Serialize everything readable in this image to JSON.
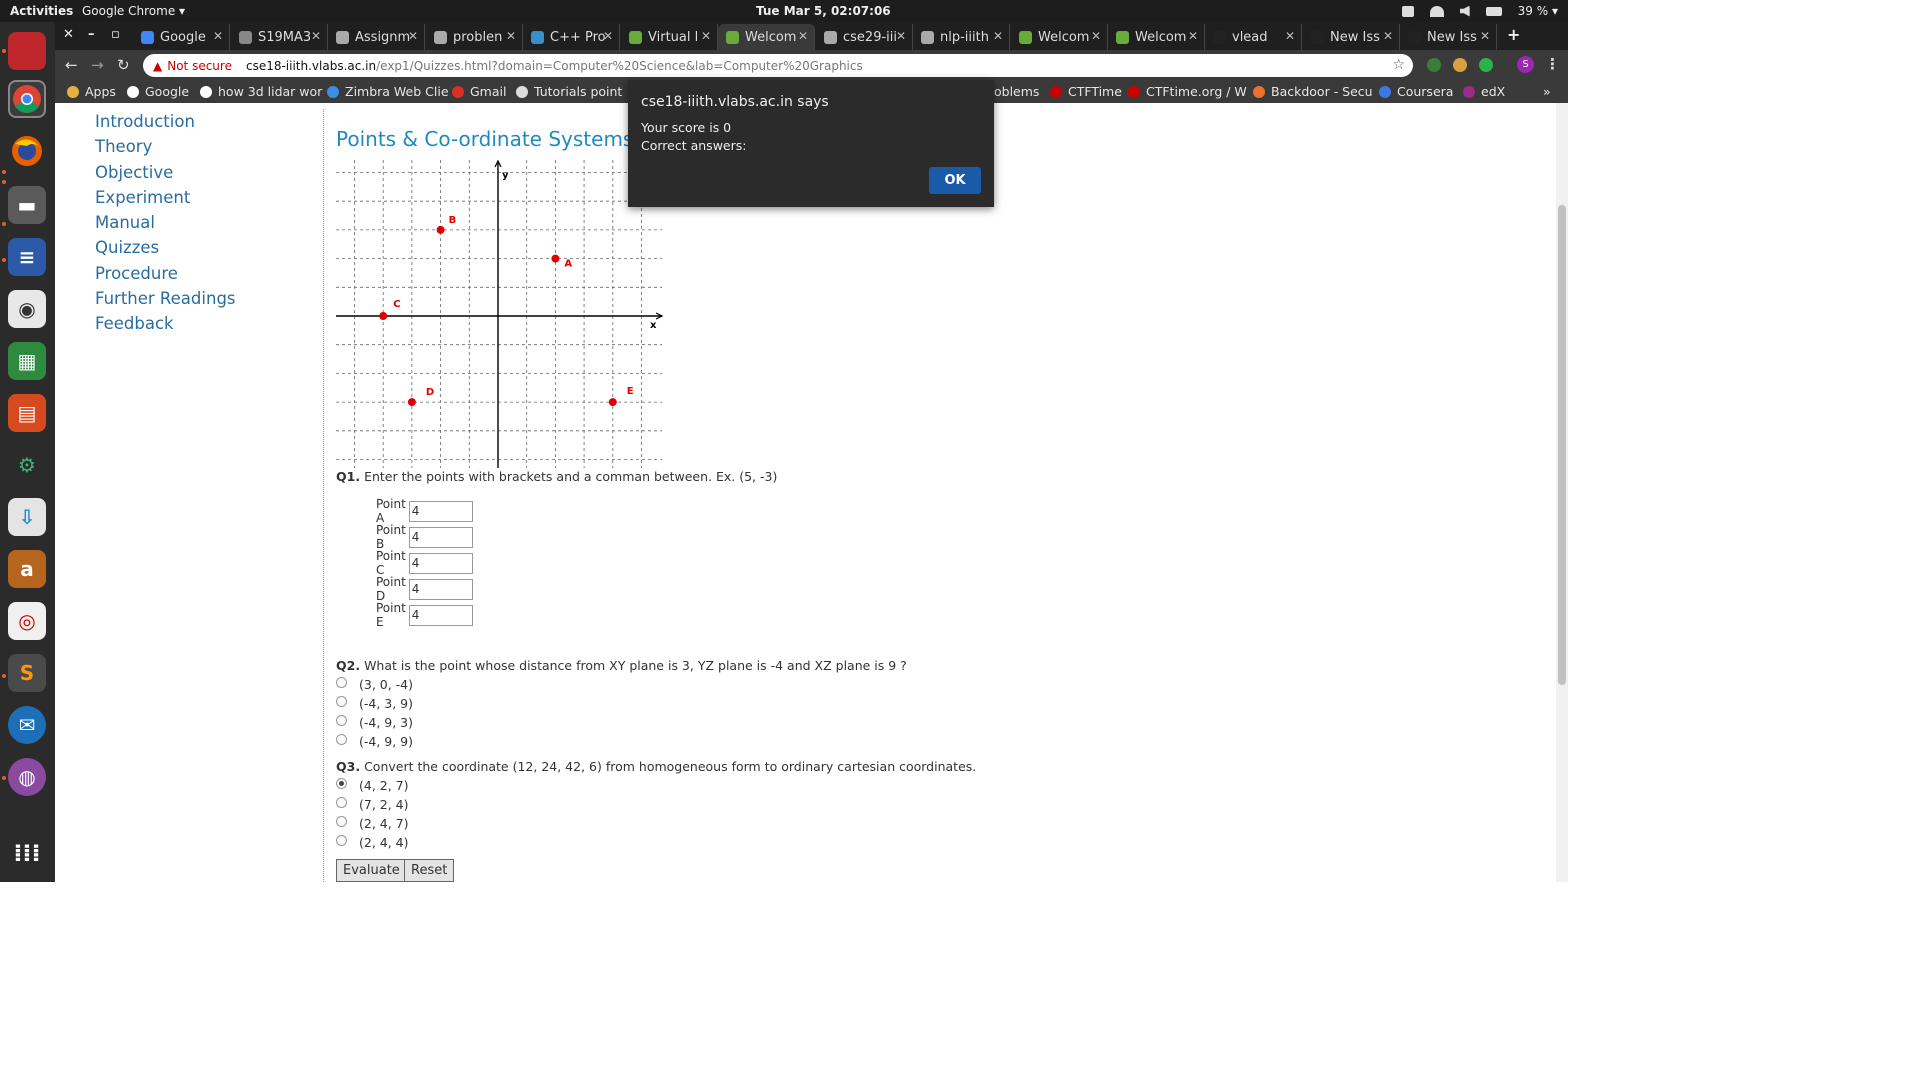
{
  "topbar": {
    "activities": "Activities",
    "app": "Google Chrome ▾",
    "clock": "Tue Mar  5, 02:07:06",
    "battery": "39 % ▾"
  },
  "tabs": [
    {
      "label": "Google",
      "color": "#4285f4"
    },
    {
      "label": "S19MA3",
      "color": "#888888"
    },
    {
      "label": "Assignm",
      "color": "#aaaaaa"
    },
    {
      "label": "problen",
      "color": "#aaaaaa"
    },
    {
      "label": "C++ Pro",
      "color": "#3a8ec9"
    },
    {
      "label": "Virtual l",
      "color": "#6aaa3a"
    },
    {
      "label": "Welcom",
      "color": "#6aaa3a"
    },
    {
      "label": "cse29-iii",
      "color": "#aaaaaa"
    },
    {
      "label": "nlp-iiith",
      "color": "#aaaaaa"
    },
    {
      "label": "Welcom",
      "color": "#6aaa3a"
    },
    {
      "label": "Welcom",
      "color": "#6aaa3a"
    },
    {
      "label": "vlead",
      "color": "#222222"
    },
    {
      "label": "New Iss",
      "color": "#222222"
    },
    {
      "label": "New Iss",
      "color": "#222222"
    }
  ],
  "address": {
    "not_secure": "Not secure",
    "host": "cse18-iiith.vlabs.ac.in",
    "path": "/exp1/Quizzes.html?domain=Computer%20Science&lab=Computer%20Graphics"
  },
  "bookmarks": [
    {
      "label": "Apps"
    },
    {
      "label": "Google"
    },
    {
      "label": "how 3d lidar wor"
    },
    {
      "label": "Zimbra Web Clie"
    },
    {
      "label": "Gmail"
    },
    {
      "label": "Tutorials point"
    },
    {
      "label": "oblems"
    },
    {
      "label": "CTFTime"
    },
    {
      "label": "CTFtime.org / W"
    },
    {
      "label": "Backdoor - Secu"
    },
    {
      "label": "Coursera"
    },
    {
      "label": "edX"
    }
  ],
  "sidenav": [
    "Introduction",
    "Theory",
    "Objective",
    "Experiment",
    "Manual",
    "Quizzes",
    "Procedure",
    "Further Readings",
    "Feedback"
  ],
  "title": "Points & Co-ordinate Systems",
  "graph": {
    "x_label": "x",
    "y_label": "y",
    "points": [
      {
        "name": "A",
        "x": 2,
        "y": 2
      },
      {
        "name": "B",
        "x": -2,
        "y": 3
      },
      {
        "name": "C",
        "x": -4,
        "y": 0
      },
      {
        "name": "D",
        "x": -3,
        "y": -3
      },
      {
        "name": "E",
        "x": 4,
        "y": -3
      }
    ]
  },
  "q1": {
    "num": "Q1.",
    "text": "Enter the points with brackets and a comman between. Ex. (5, -3)",
    "inputs": [
      {
        "label": "Point A",
        "value": "4"
      },
      {
        "label": "Point B",
        "value": "4"
      },
      {
        "label": "Point C",
        "value": "4"
      },
      {
        "label": "Point D",
        "value": "4"
      },
      {
        "label": "Point E",
        "value": "4"
      }
    ]
  },
  "q2": {
    "num": "Q2.",
    "text": "What is the point whose distance from XY plane is 3, YZ plane is -4 and XZ plane is 9 ?",
    "options": [
      "(3, 0, -4)",
      "(-4, 3, 9)",
      "(-4, 9, 3)",
      "(-4, 9, 9)"
    ],
    "selected": -1
  },
  "q3": {
    "num": "Q3.",
    "text": "Convert the coordinate (12, 24, 42, 6) from homogeneous form to ordinary cartesian coordinates.",
    "options": [
      "(4, 2, 7)",
      "(7, 2, 4)",
      "(2, 4, 7)",
      "(2, 4, 4)"
    ],
    "selected": 0
  },
  "buttons": {
    "evaluate": "Evaluate",
    "reset": "Reset"
  },
  "dialog": {
    "title": "cse18-iiith.vlabs.ac.in says",
    "line1": "Your score is 0",
    "line2": "Correct answers:",
    "ok": "OK"
  },
  "colors": {
    "point": "#e00000",
    "link": "#2a6c9e",
    "title": "#1f8ac0",
    "ok_button": "#1a5aa8"
  }
}
